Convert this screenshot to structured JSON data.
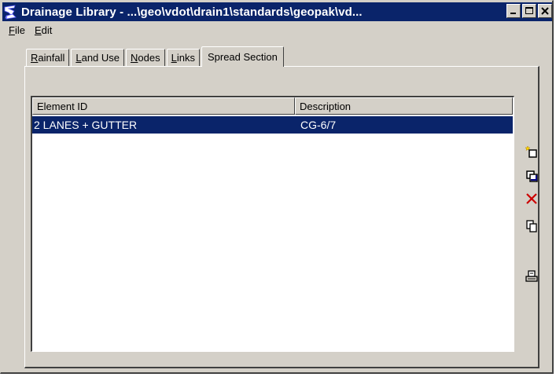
{
  "window": {
    "title": "Drainage Library - ...\\geo\\vdot\\drain1\\standards\\geopak\\vd...",
    "controls": {
      "minimize": "_",
      "maximize": "□",
      "close": "×"
    }
  },
  "menu": {
    "file": {
      "hotkey": "F",
      "rest": "ile"
    },
    "edit": {
      "hotkey": "E",
      "rest": "dit"
    }
  },
  "tabs": [
    {
      "hotkey": "R",
      "rest": "ainfall"
    },
    {
      "hotkey": "L",
      "rest": "and Use"
    },
    {
      "hotkey": "N",
      "rest": "odes"
    },
    {
      "hotkey": "L",
      "rest": "inks"
    },
    {
      "label": "Spread Section"
    }
  ],
  "active_tab": "Spread Section",
  "list": {
    "columns": [
      "Element ID",
      "Description"
    ],
    "rows": [
      {
        "element_id": "2 LANES + GUTTER",
        "description": "CG-6/7",
        "selected": true
      }
    ]
  },
  "sidebar": {
    "icons": [
      "new-item-icon",
      "duplicate-icon",
      "delete-icon",
      "copy-icon",
      "print-icon"
    ]
  },
  "colors": {
    "titlebar": "#0a246a",
    "selection": "#0a246a",
    "face": "#d4d0c8",
    "delete": "#cc0000"
  }
}
